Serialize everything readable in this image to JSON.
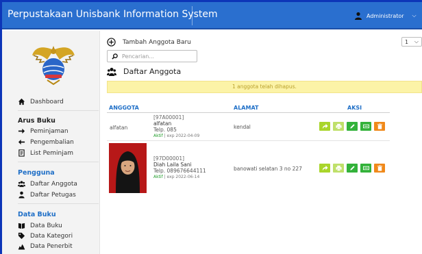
{
  "header": {
    "app_title": "Perpustakaan Unisbank Information System",
    "user_name": "Administrator"
  },
  "sidebar": {
    "dashboard": "Dashboard",
    "groups": [
      {
        "title": "Arus Buku",
        "items": [
          "Peminjaman",
          "Pengembalian",
          "List Peminjam"
        ]
      },
      {
        "title": "Pengguna",
        "items": [
          "Daftar Anggota",
          "Daftar Petugas"
        ]
      },
      {
        "title": "Data Buku",
        "items": [
          "Data Buku",
          "Data Kategori",
          "Data Penerbit"
        ]
      }
    ]
  },
  "main": {
    "add_member_label": "Tambah Anggota Baru",
    "search_placeholder": "Pencarian...",
    "page_size": "1",
    "section_title": "Daftar Anggota",
    "alert_text": "1 anggota telah dihapus.",
    "columns": {
      "member": "ANGGOTA",
      "address": "ALAMAT",
      "actions": "AKSI"
    },
    "rows": [
      {
        "left_label": "alfatan",
        "code": "[97A00001]",
        "name": "alfatan",
        "phone": "Telp. 085",
        "status": "Aktif",
        "expiry": " | exp 2022-04-09",
        "address": "kendal"
      },
      {
        "left_label": "",
        "code": "[97D00001]",
        "name": "Diah Laila Sani",
        "phone": "Telp. 089676644111",
        "status": "Aktif",
        "expiry": " | exp 2022-06-14",
        "address": "banowati selatan 3 no 227"
      }
    ]
  },
  "colors": {
    "topbar": "#2a6fcf",
    "accent_blue": "#1f6fc7",
    "alert_bg": "#fcf3a7",
    "alert_text": "#b9a02c",
    "action_lime": "#a9d52b",
    "action_green": "#33b23a",
    "action_orange": "#f0891a",
    "status_green": "#1e9c28"
  },
  "icons": {
    "add": "plus-circle-icon",
    "search": "search-icon",
    "section": "users-icon",
    "user": "user-icon",
    "actions": [
      "share-icon",
      "print-icon",
      "edit-icon",
      "card-icon",
      "trash-icon"
    ]
  }
}
